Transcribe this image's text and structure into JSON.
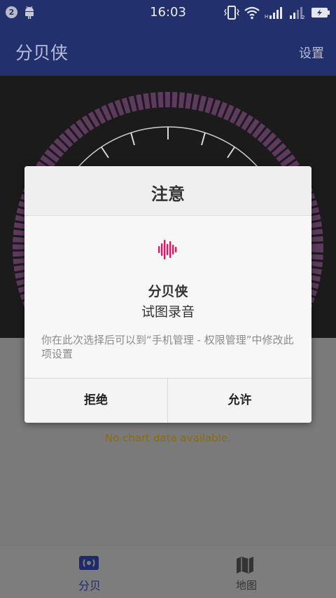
{
  "status_bar": {
    "notification_count": "2",
    "time": "16:03",
    "icons": [
      "android-icon",
      "vibrate-icon",
      "wifi-icon",
      "signal-icon",
      "signal-2-icon",
      "battery-charging-icon"
    ]
  },
  "app_bar": {
    "title": "分贝侠",
    "settings_label": "设置"
  },
  "main": {
    "empty_chart_text": "No chart data available.",
    "colors": {
      "meter_track": "#5e3a5e",
      "meter_dial": "#d8d8d8",
      "empty_text": "#8a6d10"
    }
  },
  "bottom_nav": {
    "items": [
      {
        "label": "分贝",
        "icon": "sound-meter-icon",
        "active": true
      },
      {
        "label": "地图",
        "icon": "map-icon",
        "active": false
      }
    ],
    "colors": {
      "active": "#1f2a6a",
      "inactive": "#333333"
    }
  },
  "dialog": {
    "title": "注意",
    "icon": "audio-wave-icon",
    "icon_color": "#d81b60",
    "app_name": "分贝侠",
    "action": "试图录音",
    "hint": "你在此次选择后可以到“手机管理 - 权限管理”中修改此项设置",
    "deny_label": "拒绝",
    "allow_label": "允许"
  }
}
